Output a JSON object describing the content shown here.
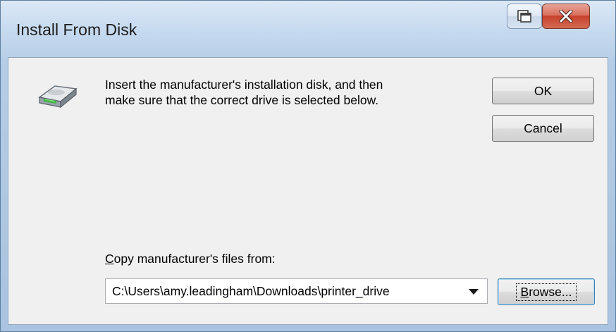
{
  "window": {
    "title": "Install From Disk"
  },
  "titlebar": {
    "restore_icon": "restore-window-icon",
    "close_icon": "close-icon"
  },
  "dialog": {
    "icon": "disk-drive-icon",
    "instruction_line1": "Insert the manufacturer's installation disk, and then",
    "instruction_line2": "make sure that the correct drive is selected below.",
    "ok_label": "OK",
    "cancel_label": "Cancel",
    "copy_label_mnemonic": "C",
    "copy_label_rest": "opy manufacturer's files from:",
    "path_value": "C:\\Users\\amy.leadingham\\Downloads\\printer_drive",
    "browse_mnemonic": "B",
    "browse_rest": "rowse..."
  },
  "colors": {
    "close_button": "#c7412d",
    "titlebar": "#c9dcf0",
    "client": "#f0f0f0"
  }
}
